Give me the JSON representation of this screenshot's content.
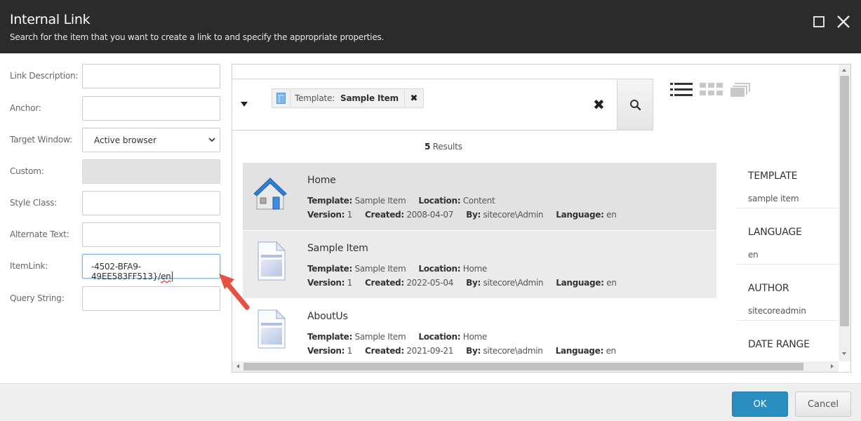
{
  "header": {
    "title": "Internal Link",
    "subtitle": "Search for the item that you want to create a link to and specify the appropriate properties.",
    "maximize_icon": "maximize-icon",
    "close_icon": "close-icon"
  },
  "form": {
    "link_description": {
      "label": "Link Description:",
      "value": ""
    },
    "anchor": {
      "label": "Anchor:",
      "value": ""
    },
    "target_window": {
      "label": "Target Window:",
      "value": "Active browser"
    },
    "custom": {
      "label": "Custom:",
      "value": ""
    },
    "style_class": {
      "label": "Style Class:",
      "value": ""
    },
    "alternate_text": {
      "label": "Alternate Text:",
      "value": ""
    },
    "item_link": {
      "label": "ItemLink:",
      "value_main": "-4502-BFA9-49EE583FF513}/",
      "value_tail": "en"
    },
    "query_string": {
      "label": "Query String:",
      "value": ""
    }
  },
  "search": {
    "facet_label": "Template:",
    "facet_value": "Sample Item",
    "facet_remove": "✖",
    "clear": "✖",
    "results_count": "5",
    "results_label": " Results"
  },
  "results": [
    {
      "name": "Home",
      "icon": "house-icon",
      "template_label": "Template:",
      "template": "Sample Item",
      "location_label": "Location:",
      "location": "Content",
      "version_label": "Version:",
      "version": "1",
      "created_label": "Created:",
      "created": "2008-04-07",
      "by_label": "By:",
      "by": "sitecore\\Admin",
      "language_label": "Language:",
      "language": "en"
    },
    {
      "name": "Sample Item",
      "icon": "document-icon",
      "template_label": "Template:",
      "template": "Sample Item",
      "location_label": "Location:",
      "location": "Home",
      "version_label": "Version:",
      "version": "1",
      "created_label": "Created:",
      "created": "2022-05-04",
      "by_label": "By:",
      "by": "sitecore\\Admin",
      "language_label": "Language:",
      "language": "en"
    },
    {
      "name": "AboutUs",
      "icon": "document-icon",
      "template_label": "Template:",
      "template": "Sample Item",
      "location_label": "Location:",
      "location": "Home",
      "version_label": "Version:",
      "version": "1",
      "created_label": "Created:",
      "created": "2021-09-21",
      "by_label": "By:",
      "by": "sitecore\\admin",
      "language_label": "Language:",
      "language": "en"
    }
  ],
  "facets": [
    {
      "heading": "TEMPLATE",
      "value": "sample item"
    },
    {
      "heading": "LANGUAGE",
      "value": "en"
    },
    {
      "heading": "AUTHOR",
      "value": "sitecoreadmin"
    },
    {
      "heading": "DATE RANGE",
      "value": ""
    }
  ],
  "footer": {
    "ok": "OK",
    "cancel": "Cancel"
  },
  "colors": {
    "header_bg": "#2b2b2b",
    "ok_button": "#2b8ec0",
    "selected_row": "#e2e2e2",
    "annotation_arrow": "#e8513f"
  }
}
